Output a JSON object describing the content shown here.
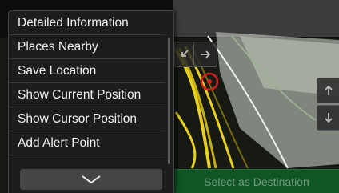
{
  "menu": {
    "items": [
      {
        "label": "Detailed Information"
      },
      {
        "label": "Places Nearby"
      },
      {
        "label": "Save Location"
      },
      {
        "label": "Show Current Position"
      },
      {
        "label": "Show Cursor Position"
      },
      {
        "label": "Add Alert Point"
      }
    ],
    "expand_icon": "chevron-down-icon"
  },
  "map": {
    "nav_left_icon": "back-arrow-icon",
    "nav_right_icon": "forward-arrow-icon",
    "pan_up_icon": "arrow-up-icon",
    "pan_down_icon": "arrow-down-icon",
    "cursor_icon": "map-cursor-icon"
  },
  "bottom_bar": {
    "select_destination_label": "Select as Destination"
  },
  "colors": {
    "menu_bg": "#1d1d1d",
    "menu_text": "#f2f2f2",
    "destination_bar": "#0f6a2a",
    "route_yellow": "#e8d020",
    "cursor_red": "#d02020"
  }
}
